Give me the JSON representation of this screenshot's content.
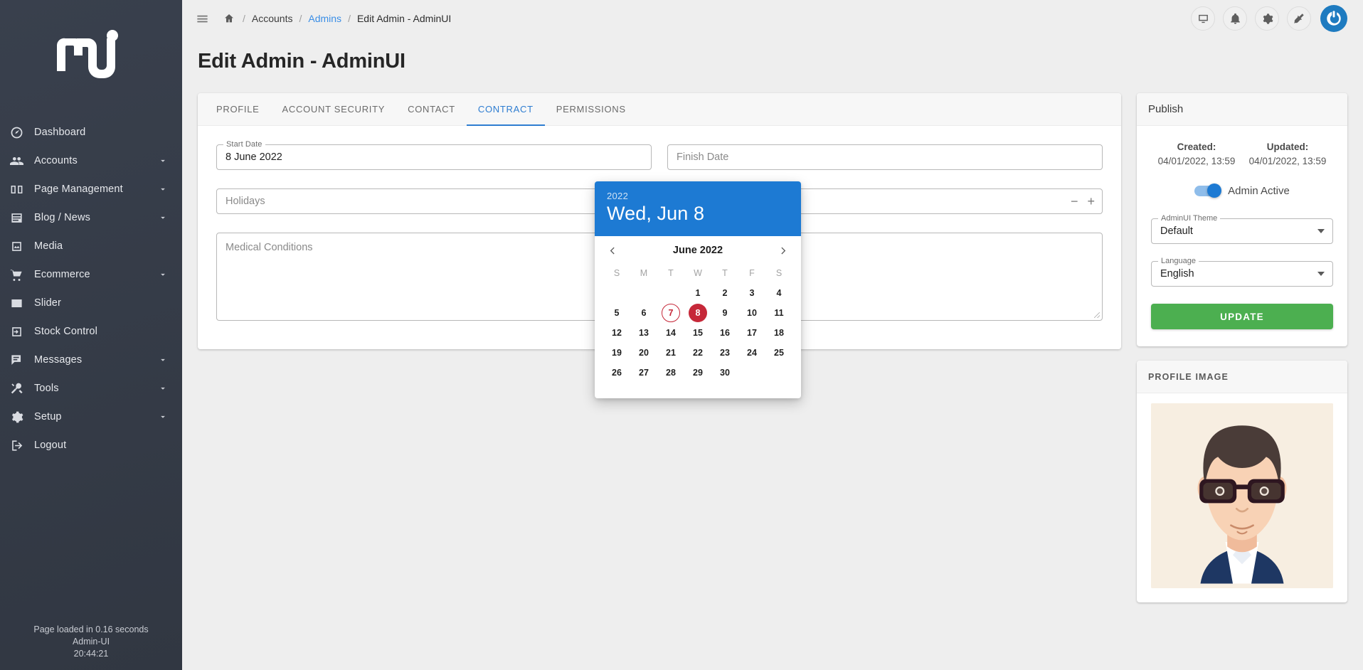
{
  "sidebar": {
    "logo_alt": "admin-ui-logo",
    "items": [
      {
        "label": "Dashboard",
        "icon": "gauge-icon",
        "expandable": false
      },
      {
        "label": "Accounts",
        "icon": "people-icon",
        "expandable": true
      },
      {
        "label": "Page Management",
        "icon": "book-icon",
        "expandable": true
      },
      {
        "label": "Blog / News",
        "icon": "article-icon",
        "expandable": true
      },
      {
        "label": "Media",
        "icon": "photo-library-icon",
        "expandable": false
      },
      {
        "label": "Ecommerce",
        "icon": "shopping-cart-icon",
        "expandable": true
      },
      {
        "label": "Slider",
        "icon": "image-icon",
        "expandable": false
      },
      {
        "label": "Stock Control",
        "icon": "login-box-icon",
        "expandable": false
      },
      {
        "label": "Messages",
        "icon": "chat-icon",
        "expandable": true
      },
      {
        "label": "Tools",
        "icon": "tools-icon",
        "expandable": true
      },
      {
        "label": "Setup",
        "icon": "gear-icon",
        "expandable": true
      },
      {
        "label": "Logout",
        "icon": "logout-icon",
        "expandable": false
      }
    ],
    "footer": {
      "load_time": "Page loaded in 0.16 seconds",
      "app_name": "Admin-UI",
      "clock": "20:44:21"
    }
  },
  "topbar": {
    "menu_icon": "hamburger-icon",
    "breadcrumb": {
      "home_icon": "home-icon",
      "separator": "/",
      "items": [
        {
          "label": "Accounts",
          "state": "plain"
        },
        {
          "label": "Admins",
          "state": "link"
        },
        {
          "label": "Edit Admin - AdminUI",
          "state": "current"
        }
      ]
    },
    "icons": [
      {
        "name": "monitor-icon"
      },
      {
        "name": "bell-icon"
      },
      {
        "name": "gear-icon"
      },
      {
        "name": "broom-icon"
      }
    ],
    "avatar_icon": "gravatar-power-icon"
  },
  "page": {
    "title": "Edit Admin - AdminUI"
  },
  "tabs": [
    {
      "label": "PROFILE",
      "active": false
    },
    {
      "label": "ACCOUNT SECURITY",
      "active": false
    },
    {
      "label": "CONTACT",
      "active": false
    },
    {
      "label": "CONTRACT",
      "active": true
    },
    {
      "label": "PERMISSIONS",
      "active": false
    }
  ],
  "form": {
    "start_date": {
      "legend": "Start Date",
      "value": "8 June 2022"
    },
    "finish_date": {
      "placeholder": "Finish Date",
      "value": ""
    },
    "holidays": {
      "placeholder": "Holidays",
      "value": "",
      "minus": "−",
      "plus": "+"
    },
    "medical_conditions": {
      "placeholder": "Medical Conditions",
      "value": ""
    }
  },
  "datepicker": {
    "year": "2022",
    "headline": "Wed, Jun 8",
    "month_label": "June 2022",
    "prev_icon": "chevron-left-icon",
    "next_icon": "chevron-right-icon",
    "day_initials": [
      "S",
      "M",
      "T",
      "W",
      "T",
      "F",
      "S"
    ],
    "lead_blanks": 3,
    "days": [
      1,
      2,
      3,
      4,
      5,
      6,
      7,
      8,
      9,
      10,
      11,
      12,
      13,
      14,
      15,
      16,
      17,
      18,
      19,
      20,
      21,
      22,
      23,
      24,
      25,
      26,
      27,
      28,
      29,
      30
    ],
    "today": 7,
    "selected": 8,
    "header_color": "#1d7ad3",
    "selected_color": "#c62839"
  },
  "publish": {
    "title": "Publish",
    "created_label": "Created:",
    "created_value": "04/01/2022, 13:59",
    "updated_label": "Updated:",
    "updated_value": "04/01/2022, 13:59",
    "toggle_label": "Admin Active",
    "toggle_on": true,
    "theme": {
      "legend": "AdminUI Theme",
      "value": "Default"
    },
    "language": {
      "legend": "Language",
      "value": "English"
    },
    "update_button": "UPDATE",
    "update_color": "#4caf50"
  },
  "profile_image": {
    "title": "PROFILE IMAGE",
    "alt": "admin-avatar"
  }
}
